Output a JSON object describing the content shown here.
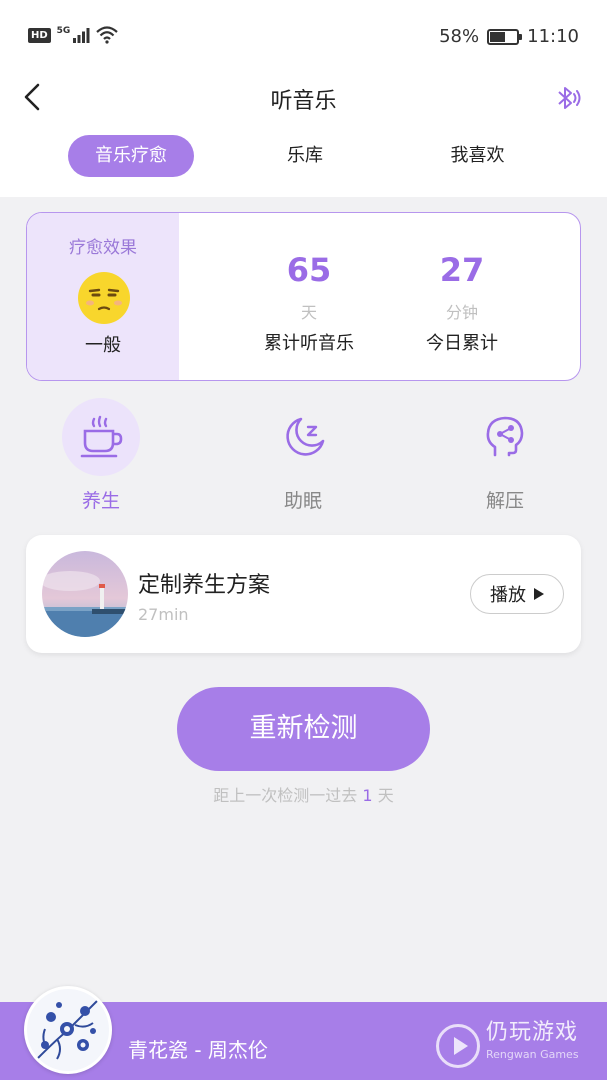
{
  "status_bar": {
    "left_badge": "HD",
    "network": "5G",
    "battery": "58%",
    "battery_level": 0.58,
    "time": "11:10"
  },
  "nav": {
    "title": "听音乐"
  },
  "tabs": [
    {
      "label": "音乐疗愈",
      "active": true
    },
    {
      "label": "乐库",
      "active": false
    },
    {
      "label": "我喜欢",
      "active": false
    }
  ],
  "effect_card": {
    "label": "疗愈效果",
    "level": "一般",
    "stats": [
      {
        "value": "65",
        "unit": "天",
        "caption": "累计听音乐"
      },
      {
        "value": "27",
        "unit": "分钟",
        "caption": "今日累计"
      }
    ]
  },
  "categories": [
    {
      "label": "养生",
      "icon": "tea-cup-icon",
      "active": true
    },
    {
      "label": "助眠",
      "icon": "moon-sleep-icon",
      "active": false
    },
    {
      "label": "解压",
      "icon": "head-relief-icon",
      "active": false
    }
  ],
  "plan": {
    "title": "定制养生方案",
    "duration": "27min",
    "play_label": "播放"
  },
  "redetect": {
    "button_label": "重新检测",
    "last_prefix": "距上一次检测一过去",
    "last_days": "1",
    "last_suffix": "天"
  },
  "player": {
    "track": "青花瓷 - 周杰伦"
  },
  "watermark": {
    "cn": "仍玩游戏",
    "en": "Rengwan Games"
  },
  "colors": {
    "accent": "#a77ee8",
    "accent_text": "#9a6ce6",
    "accent_light": "#ede4fb",
    "background": "#f1f1f3"
  }
}
